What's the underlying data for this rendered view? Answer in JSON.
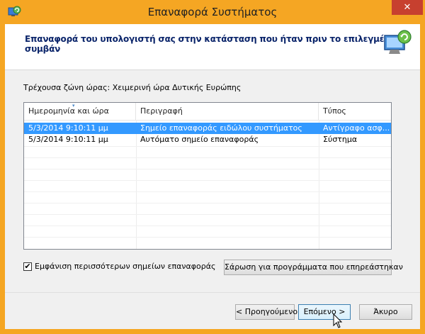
{
  "window": {
    "title": "Επαναφορά Συστήματος",
    "close_glyph": "✕",
    "app_icon": "system-restore-icon",
    "titlebar_color": "#f5a623",
    "close_color": "#c7402f"
  },
  "header": {
    "text": "Επαναφορά του υπολογιστή σας στην κατάσταση που ήταν πριν το επιλεγμένο συμβάν",
    "icon": "restore-monitor-icon"
  },
  "timezone_label": "Τρέχουσα ζώνη ώρας: Χειμερινή ώρα Δυτικής Ευρώπης",
  "table": {
    "columns": [
      "Ημερομηνία και ώρα",
      "Περιγραφή",
      "Τύπος"
    ],
    "rows": [
      {
        "date": "5/3/2014 9:10:11 μμ",
        "description": "Σημείο επαναφοράς ειδώλου συστήματος",
        "type": "Αντίγραφο ασφ...",
        "selected": true
      },
      {
        "date": "5/3/2014 9:10:11 μμ",
        "description": "Αυτόματο σημείο επαναφοράς",
        "type": "Σύστημα",
        "selected": false
      }
    ],
    "selection_color": "#3399ff"
  },
  "show_more_checkbox": {
    "label": "Εμφάνιση περισσότερων σημείων επαναφοράς",
    "checked": true,
    "check_glyph": "✔"
  },
  "buttons": {
    "scan": "Σάρωση για προγράμματα που επηρεάστηκαν",
    "back": "< Προηγούμενο",
    "next": "Επόμενο >",
    "cancel": "Άκυρο"
  }
}
